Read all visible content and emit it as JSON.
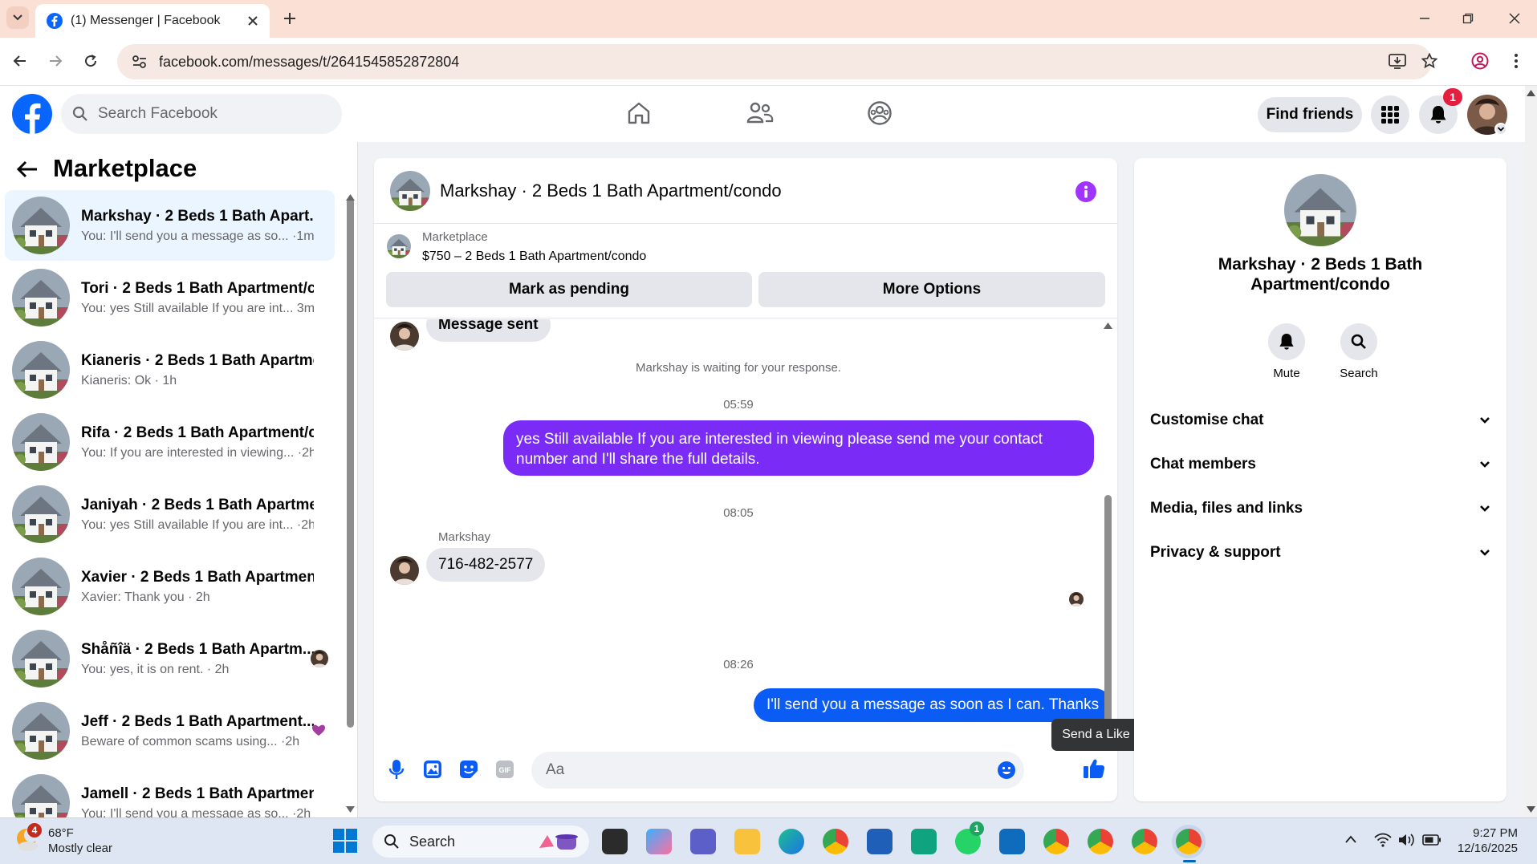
{
  "browser": {
    "tab_title": "(1) Messenger | Facebook",
    "url": "facebook.com/messages/t/2641545852872804"
  },
  "fb_header": {
    "search_placeholder": "Search Facebook",
    "find_friends_label": "Find friends",
    "notification_count": "1",
    "brand_color": "#0866ff"
  },
  "left_panel": {
    "title": "Marketplace",
    "conversations": [
      {
        "name": "Markshay · 2 Beds 1 Bath Apart...",
        "preview": "You: I'll send you a message as so... ·1m",
        "active": true
      },
      {
        "name": "Tori · 2 Beds 1 Bath Apartment/c...",
        "preview": "You: yes Still available If you are int... 3m"
      },
      {
        "name": "Kianeris · 2 Beds 1 Bath Apartme...",
        "preview": "Kianeris: Ok · 1h"
      },
      {
        "name": "Rifa · 2 Beds 1 Bath Apartment/c...",
        "preview": "You: If you are interested in viewing... ·2h"
      },
      {
        "name": "Janiyah · 2 Beds 1 Bath Apartme...",
        "preview": "You: yes Still available If you are int... ·2h"
      },
      {
        "name": "Xavier · 2 Beds 1 Bath Apartmen...",
        "preview": "Xavier: Thank you · 2h"
      },
      {
        "name": "Shåñîä · 2 Beds 1 Bath Apartm...",
        "preview": "You: yes, it is on rent. · 2h"
      },
      {
        "name": "Jeff · 2 Beds 1 Bath Apartment...",
        "preview": "Beware of common scams using... ·2h"
      },
      {
        "name": "Jamell · 2 Beds 1 Bath Apartmen...",
        "preview": "You: I'll send you a message as so... ·2h"
      }
    ]
  },
  "chat": {
    "header_title": "Markshay · 2 Beds 1 Bath Apartment/condo",
    "marketplace_label": "Marketplace",
    "listing": "$750 – 2 Beds 1 Bath Apartment/condo",
    "mark_pending_label": "Mark as pending",
    "more_options_label": "More Options",
    "messages": {
      "message_sent": "Message sent",
      "waiting_note": "Markshay is waiting for your response.",
      "time_1": "05:59",
      "outgoing_1": "yes Still available If you are interested in viewing please send me your contact number and I'll share the full details.",
      "time_2": "08:05",
      "sender_name": "Markshay",
      "incoming_phone": "716-482-2577",
      "time_3": "08:26",
      "outgoing_2": "I'll send you a message as soon as I can. Thanks"
    },
    "composer_placeholder": "Aa",
    "like_tooltip": "Send a Like",
    "purple": "#7a2cf6",
    "blue": "#0a5cf5"
  },
  "info_panel": {
    "name": "Markshay · 2 Beds 1 Bath Apartment/condo",
    "mute_label": "Mute",
    "search_label": "Search",
    "sections": [
      "Customise chat",
      "Chat members",
      "Media, files and links",
      "Privacy & support"
    ]
  },
  "taskbar": {
    "weather_temp": "68°F",
    "weather_desc": "Mostly clear",
    "weather_badge": "4",
    "search_label": "Search",
    "whatsapp_badge": "1",
    "time": "9:27 PM",
    "date": "12/16/2025"
  }
}
